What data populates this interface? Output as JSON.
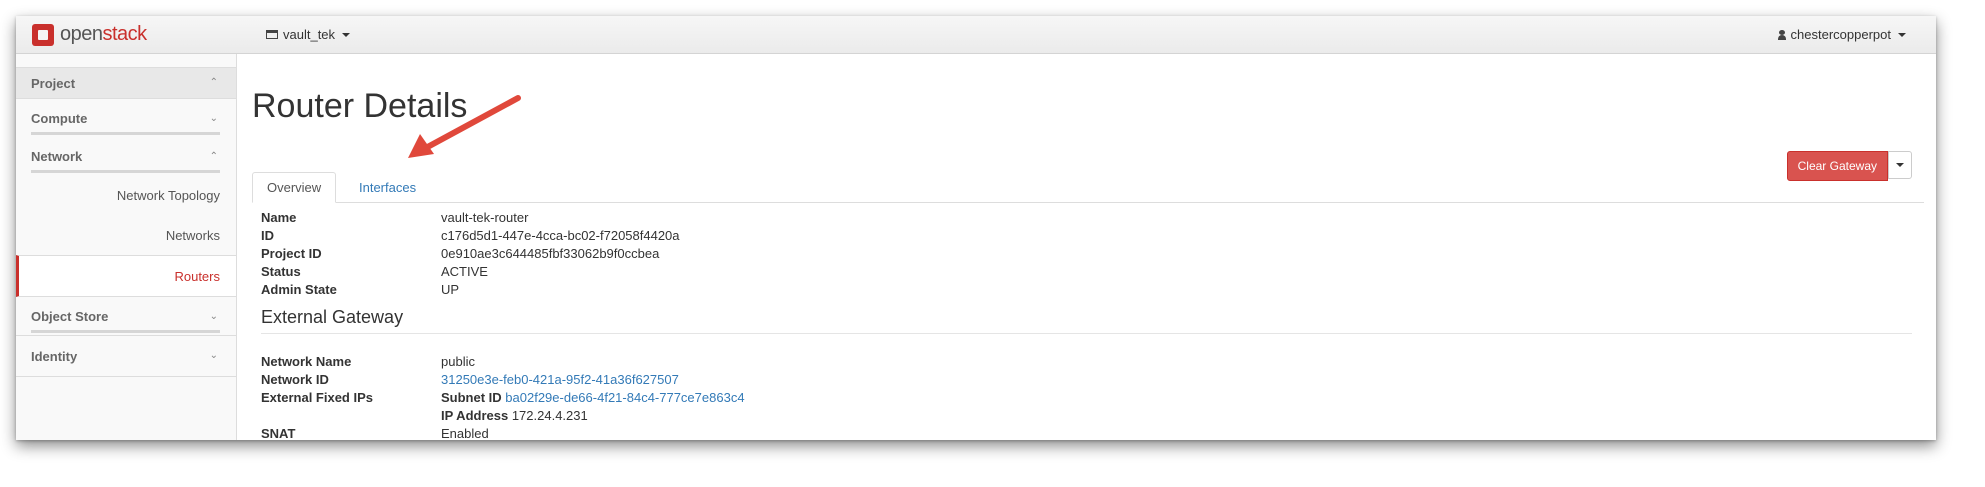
{
  "brand": {
    "name_prefix": "open",
    "name_suffix": "stack"
  },
  "topbar": {
    "project": "vault_tek",
    "user": "chestercopperpot"
  },
  "sidebar": {
    "sections": [
      {
        "label": "Project"
      },
      {
        "label": "Compute"
      },
      {
        "label": "Network"
      },
      {
        "label": "Object Store"
      },
      {
        "label": "Identity"
      }
    ],
    "network_items": [
      "Network Topology",
      "Networks",
      "Routers"
    ],
    "active_item": "Routers"
  },
  "page": {
    "title": "Router Details"
  },
  "actions": {
    "clear_gateway": "Clear Gateway"
  },
  "tabs": [
    {
      "label": "Overview"
    },
    {
      "label": "Interfaces"
    }
  ],
  "overview": [
    {
      "key": "Name",
      "value": "vault-tek-router"
    },
    {
      "key": "ID",
      "value": "c176d5d1-447e-4cca-bc02-f72058f4420a"
    },
    {
      "key": "Project ID",
      "value": "0e910ae3c644485fbf33062b9f0ccbea"
    },
    {
      "key": "Status",
      "value": "ACTIVE"
    },
    {
      "key": "Admin State",
      "value": "UP"
    }
  ],
  "external_gateway": {
    "heading": "External Gateway",
    "network_name_label": "Network Name",
    "network_name": "public",
    "network_id_label": "Network ID",
    "network_id": "31250e3e-feb0-421a-95f2-41a36f627507",
    "fixed_ips_label": "External Fixed IPs",
    "subnet_id_label": "Subnet ID",
    "subnet_id": "ba02f29e-de66-4f21-84c4-777ce7e863c4",
    "ip_address_label": "IP Address",
    "ip_address": "172.24.4.231",
    "snat_label": "SNAT",
    "snat": "Enabled"
  },
  "colors": {
    "accent": "#c9302c",
    "link": "#337ab7",
    "annotation_arrow": "#e0483b"
  }
}
